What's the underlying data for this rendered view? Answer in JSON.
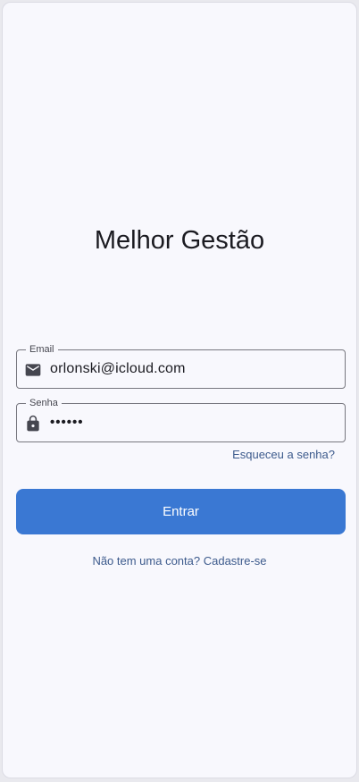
{
  "app": {
    "title": "Melhor Gestão"
  },
  "form": {
    "email": {
      "label": "Email",
      "value": "orlonski@icloud.com",
      "icon": "email-icon"
    },
    "password": {
      "label": "Senha",
      "value": "••••••",
      "icon": "lock-icon"
    },
    "forgot_label": "Esqueceu a senha?",
    "submit_label": "Entrar",
    "signup_label": "Não tem uma conta? Cadastre-se"
  },
  "colors": {
    "background": "#f8f8fd",
    "primary": "#3a78d3",
    "link": "#3c5a8c",
    "text": "#1b1b21",
    "outline": "#77777f"
  }
}
